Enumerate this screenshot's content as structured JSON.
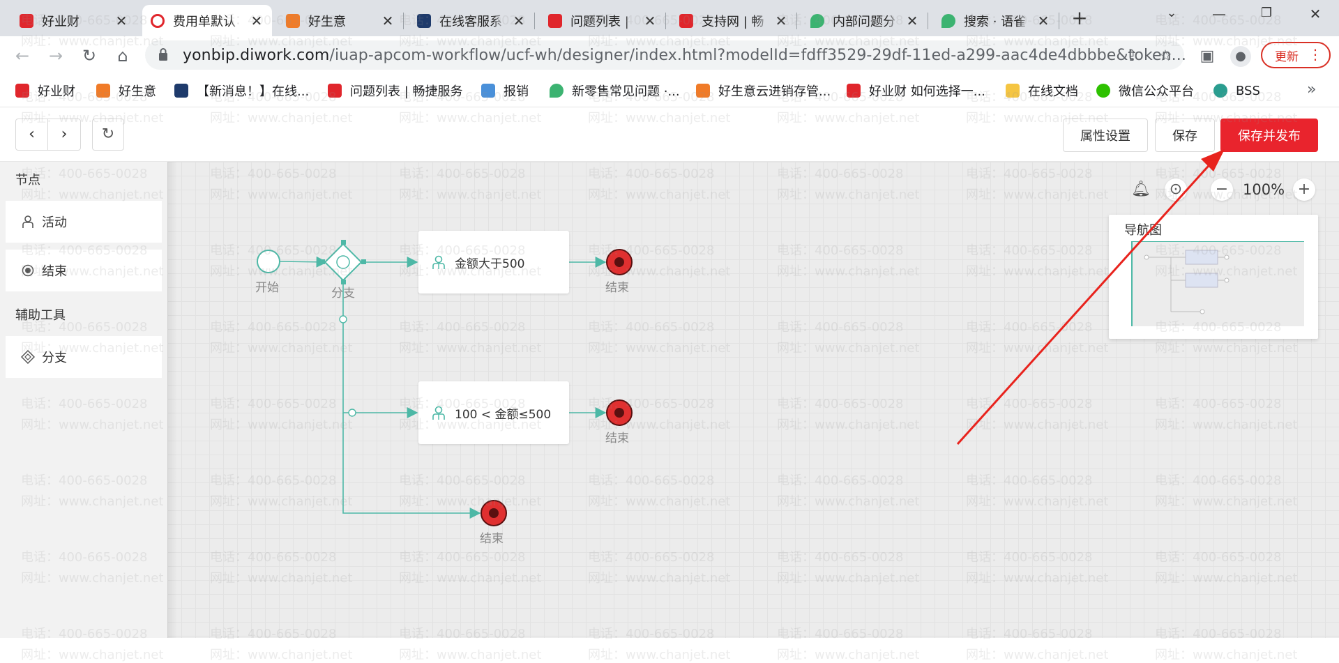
{
  "browser": {
    "tabs": [
      {
        "title": "好业财",
        "active": false,
        "icon_color": "#e0262c"
      },
      {
        "title": "费用单默认",
        "active": true,
        "icon_color": "#e0262c"
      },
      {
        "title": "好生意",
        "active": false,
        "icon_color": "#f07b28"
      },
      {
        "title": "在线客服系",
        "active": false,
        "icon_color": "#1e3a6b"
      },
      {
        "title": "问题列表 |",
        "active": false,
        "icon_color": "#e0262c"
      },
      {
        "title": "支持网 | 畅",
        "active": false,
        "icon_color": "#e0262c"
      },
      {
        "title": "内部问题分",
        "active": false,
        "icon_color": "#3cb371"
      },
      {
        "title": "搜索 · 语雀",
        "active": false,
        "icon_color": "#3cb371"
      }
    ],
    "url_domain": "yonbip.diwork.com",
    "url_path": "/iuap-apcom-workflow/ucf-wh/designer/index.html?modelId=fdff3529-29df-11ed-a299-aac4de4dbbbe&token...",
    "update_label": "更新",
    "bookmarks": [
      {
        "label": "好业财",
        "icon_color": "#e0262c"
      },
      {
        "label": "好生意",
        "icon_color": "#f07b28"
      },
      {
        "label": "【新消息！】在线...",
        "icon_color": "#1e3a6b"
      },
      {
        "label": "问题列表 | 畅捷服务",
        "icon_color": "#e0262c"
      },
      {
        "label": "报销",
        "icon_color": "#4a90d9"
      },
      {
        "label": "新零售常见问题 ·...",
        "icon_color": "#3cb371"
      },
      {
        "label": "好生意云进销存管...",
        "icon_color": "#f07b28"
      },
      {
        "label": "好业财 如何选择一...",
        "icon_color": "#e0262c"
      },
      {
        "label": "在线文档",
        "icon_color": "#f5c542"
      },
      {
        "label": "微信公众平台",
        "icon_color": "#2dc100"
      },
      {
        "label": "BSS",
        "icon_color": "#2a9d8f"
      }
    ]
  },
  "header": {
    "props_label": "属性设置",
    "save_label": "保存",
    "publish_label": "保存并发布"
  },
  "panel": {
    "nodes_title": "节点",
    "activity_label": "活动",
    "end_label": "结束",
    "tools_title": "辅助工具",
    "branch_label": "分支"
  },
  "flow": {
    "start_label": "开始",
    "branch_label": "分支",
    "activity1_label": "金额大于500",
    "activity2_label": "100 < 金额≤500",
    "end1_label": "结束",
    "end2_label": "结束",
    "end3_label": "结束"
  },
  "zoom": {
    "value": "100%"
  },
  "minimap": {
    "title": "导航图"
  },
  "watermark": {
    "phone": "电话：400-665-0028",
    "site": "网址：www.chanjet.net"
  },
  "colors": {
    "accent": "#e9242d",
    "flow": "#4db8a6",
    "end_node": "#e03030"
  }
}
